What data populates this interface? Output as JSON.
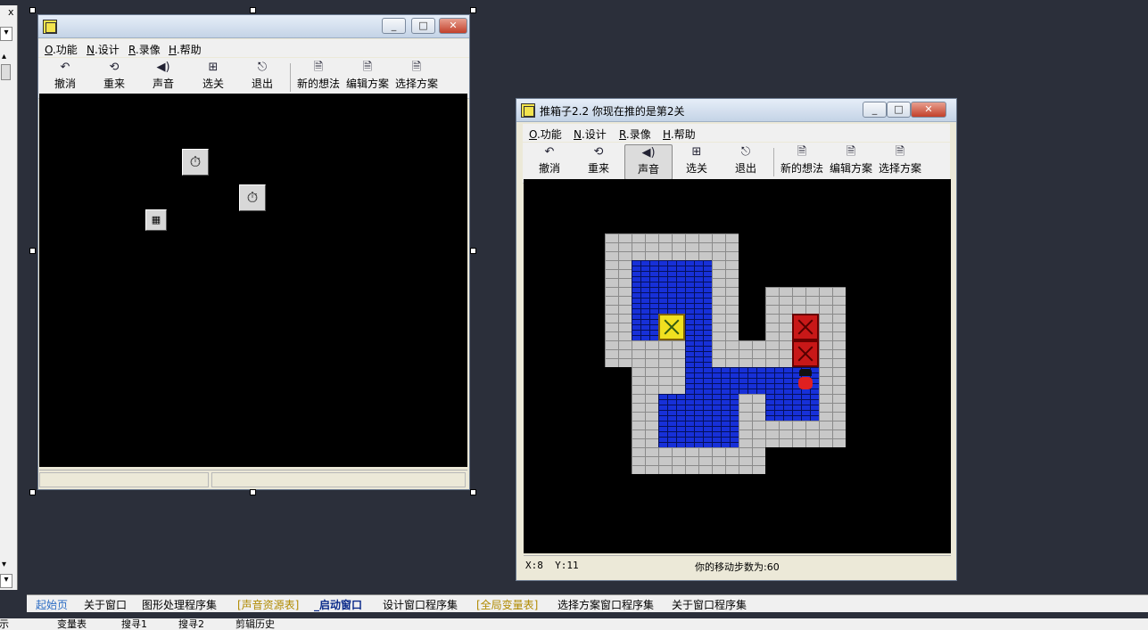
{
  "left_strip": {
    "close_label": "x",
    "arrow_up": "▴",
    "arrow_down": "▾"
  },
  "designer_form": {
    "menu": [
      {
        "key": "O",
        "label": ".功能"
      },
      {
        "key": "N",
        "label": ".设计"
      },
      {
        "key": "R",
        "label": ".录像"
      },
      {
        "key": "H",
        "label": ".帮助"
      }
    ],
    "toolbar": [
      "撤消",
      "重来",
      "声音",
      "选关",
      "退出",
      "新的想法",
      "编辑方案",
      "选择方案"
    ],
    "timer_icon": "stopwatch-icon",
    "image_icon": "image-box-icon"
  },
  "game_window": {
    "title": "推箱子2.2 你现在推的是第2关",
    "menu": [
      {
        "key": "O",
        "label": ".功能"
      },
      {
        "key": "N",
        "label": ".设计"
      },
      {
        "key": "R",
        "label": ".录像"
      },
      {
        "key": "H",
        "label": ".帮助"
      }
    ],
    "toolbar": [
      "撤消",
      "重来",
      "声音",
      "选关",
      "退出",
      "新的想法",
      "编辑方案",
      "选择方案"
    ],
    "sound_pressed": true,
    "status_left": "X:8  Y:11",
    "status_right": "你的移动步数为:60"
  },
  "window_buttons": {
    "min": "_",
    "max": "□",
    "close": "✕"
  },
  "tabs": [
    "起始页",
    "关于窗口",
    "图形处理程序集",
    "[声音资源表]",
    "_启动窗口",
    "设计窗口程序集",
    "[全局变量表]",
    "选择方案窗口程序集",
    "关于窗口程序集"
  ],
  "active_tab": "_启动窗口",
  "bottom_panel": [
    "提示",
    "变量表",
    "搜寻1",
    "搜寻2",
    "剪辑历史"
  ],
  "colors": {
    "background": "#2b2f3a",
    "floor": "#1730d8",
    "wall": "#c8c8c8",
    "box": "#c81818",
    "box_on_target": "#f0e020"
  }
}
